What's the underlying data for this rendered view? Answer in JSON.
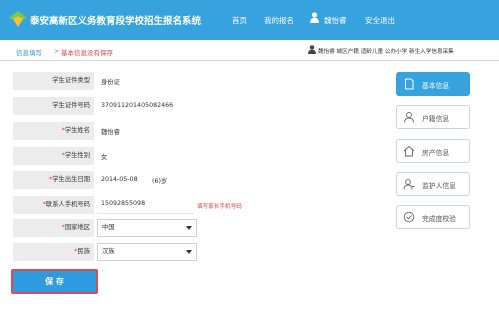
{
  "header": {
    "site_title": "泰安高新区义务教育段学校招生报名系统",
    "nav": [
      "首页",
      "我的报名",
      "魏怡睿",
      "安全退出"
    ]
  },
  "breadcrumb": {
    "home": "信息填写",
    "separator": ">",
    "current": "基本信息没有保存"
  },
  "status_text": "魏怡睿 城区户籍 适龄儿童 公办小学 新生入学信息采集",
  "form": {
    "id_type_label": "学生证件类型",
    "id_type_value": "身份证",
    "id_number_label": "学生证件号码",
    "id_number_value": "370911201405082466",
    "name_label": "*学生姓名",
    "name_value": "魏怡睿",
    "gender_label": "*学生性别",
    "gender_value": "女",
    "birth_label": "*学生出生日期",
    "birth_value": "2014-05-08",
    "age_value": "(6)岁",
    "phone_label": "*联系人手机号码",
    "phone_value": "15092855098",
    "phone_hint": "填写家长手机号码",
    "country_label": "*国家地区",
    "country_value": "中国",
    "ethnic_label": "*民族",
    "ethnic_value": "汉族"
  },
  "save_label": "保 存",
  "sidebar": [
    "基本信息",
    "户籍信息",
    "房产信息",
    "监护人信息",
    "完成度校验"
  ]
}
